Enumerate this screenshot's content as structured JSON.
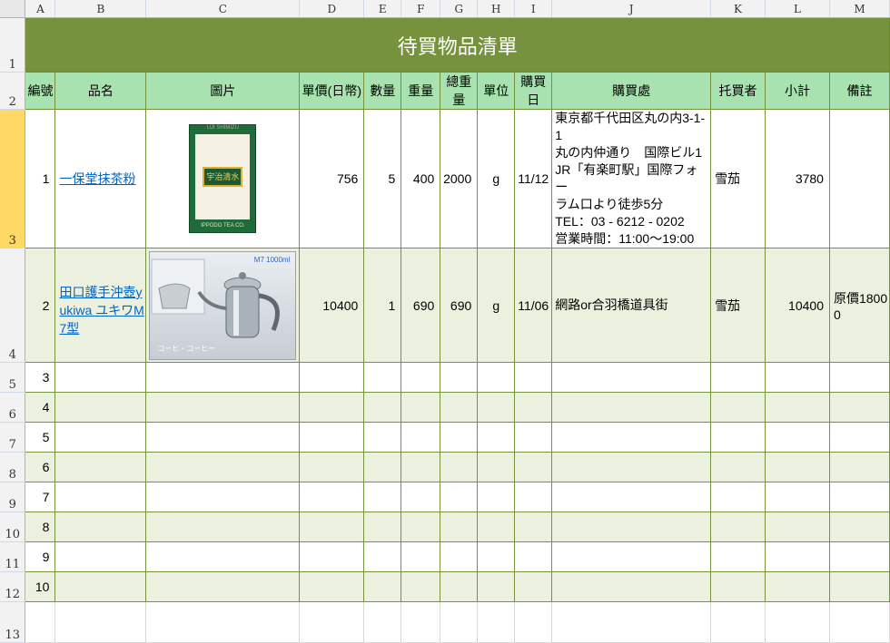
{
  "columns": [
    "A",
    "B",
    "C",
    "D",
    "E",
    "F",
    "G",
    "H",
    "I",
    "J",
    "K",
    "L",
    "M"
  ],
  "row_numbers": [
    "1",
    "2",
    "3",
    "4",
    "5",
    "6",
    "7",
    "8",
    "9",
    "10",
    "11",
    "12",
    "13"
  ],
  "title": "待買物品清單",
  "headers": [
    "編號",
    "品名",
    "圖片",
    "單價(日幣)",
    "數量",
    "重量",
    "總重量",
    "單位",
    "購買日",
    "購買處",
    "托買者",
    "小計",
    "備註"
  ],
  "items": [
    {
      "no": "1",
      "name": "一保堂抹茶粉",
      "price": "756",
      "qty": "5",
      "weight": "400",
      "total_weight": "2000",
      "unit": "g",
      "date": "11/12",
      "place_lines": [
        "東京都千代田区丸の内3-1-1",
        "丸の内仲通り　国際ビル1",
        "JR「有楽町駅」国際フォー",
        "ラム口より徒歩5分",
        "TEL：03 - 6212 - 0202",
        "営業時間：11:00～19:00"
      ],
      "buyer": "雪茄",
      "subtotal": "3780",
      "note": "",
      "image": {
        "icon": "matcha-package-image",
        "top": "UJI SHIMIZU",
        "badge": "宇治清水",
        "bottom": "IPPODO TEA CO."
      }
    },
    {
      "no": "2",
      "name": "田口護手沖壺yukiwa ユキワM7型",
      "price": "10400",
      "qty": "1",
      "weight": "690",
      "total_weight": "690",
      "unit": "g",
      "date": "11/06",
      "place_lines": [
        "網路or合羽橋道具街"
      ],
      "buyer": "雪茄",
      "subtotal": "10400",
      "note": "原價18000",
      "image": {
        "icon": "kettle-image",
        "tag": "M7 1000ml",
        "caption": "コーヒ・コーヒー"
      }
    }
  ],
  "empty_numbers": [
    "3",
    "4",
    "5",
    "6",
    "7",
    "8",
    "9",
    "10"
  ],
  "colors": {
    "title_bg": "#76923c",
    "header_bg": "#a9e2b1",
    "band": "#ebf1de",
    "selected_row": "#ffd966"
  }
}
